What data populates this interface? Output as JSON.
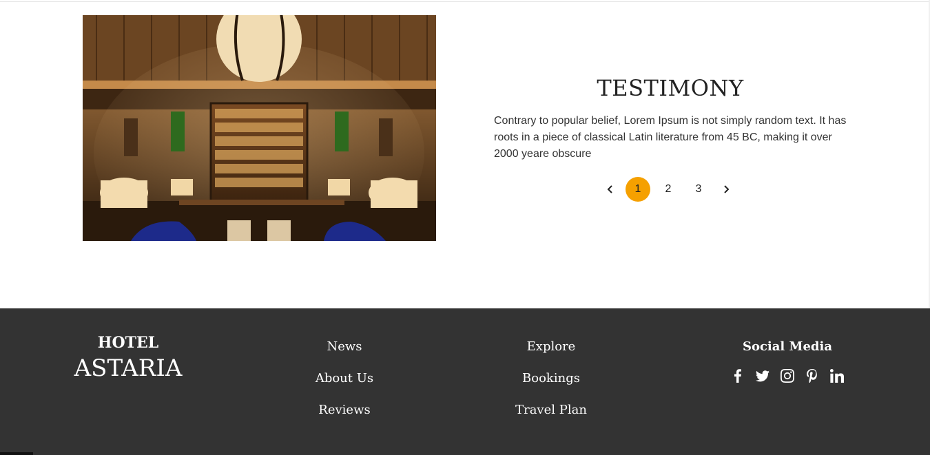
{
  "testimony": {
    "title": "TESTIMONY",
    "text": "Contrary to popular belief, Lorem Ipsum is not simply random text. It has roots in a piece of classical Latin literature from 45 BC, making it over 2000 yeare obscure"
  },
  "pagination": {
    "pages": [
      "1",
      "2",
      "3"
    ],
    "active": "1",
    "prev_icon": "chevron-left-icon",
    "next_icon": "chevron-right-icon",
    "accent": "#f5a000"
  },
  "footer": {
    "brand": {
      "line1": "HOTEL",
      "line2": "ASTARIA"
    },
    "links_col1": [
      "News",
      "About Us",
      "Reviews"
    ],
    "links_col2": [
      "Explore",
      "Bookings",
      "Travel Plan"
    ],
    "social": {
      "title": "Social Media",
      "icons": [
        "facebook-icon",
        "twitter-icon",
        "instagram-icon",
        "pinterest-icon",
        "linkedin-icon"
      ]
    },
    "background": "#333333"
  }
}
